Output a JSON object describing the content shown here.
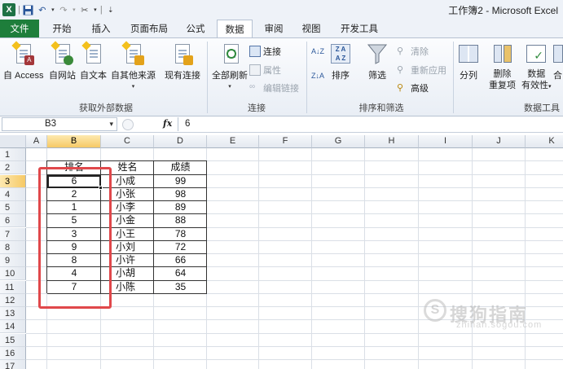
{
  "window": {
    "title": "工作簿2 - Microsoft Excel"
  },
  "quick_access": {
    "icons": [
      "excel-logo",
      "save-icon",
      "undo-icon",
      "redo-icon",
      "customize-icon"
    ]
  },
  "tabs": [
    {
      "label": "文件",
      "kind": "file"
    },
    {
      "label": "开始"
    },
    {
      "label": "插入"
    },
    {
      "label": "页面布局"
    },
    {
      "label": "公式"
    },
    {
      "label": "数据",
      "active": true
    },
    {
      "label": "审阅"
    },
    {
      "label": "视图"
    },
    {
      "label": "开发工具"
    }
  ],
  "ribbon": {
    "get_external": {
      "group_label": "获取外部数据",
      "buttons": [
        "自 Access",
        "自网站",
        "自文本",
        "自其他来源",
        "现有连接"
      ]
    },
    "connections": {
      "group_label": "连接",
      "refresh_all": "全部刷新",
      "connections": "连接",
      "properties": "属性",
      "edit_links": "编辑链接"
    },
    "sort_filter": {
      "group_label": "排序和筛选",
      "sort_az": "A↓Z",
      "sort_za": "Z↓A",
      "sort": "排序",
      "filter": "筛选",
      "clear": "清除",
      "reapply": "重新应用",
      "advanced": "高级"
    },
    "data_tools": {
      "group_label": "数据工具",
      "text_to_columns": "分列",
      "remove_duplicates_1": "删除",
      "remove_duplicates_2": "重复项",
      "data_validation_1": "数据",
      "data_validation_2": "有效性",
      "consolidate": "合"
    }
  },
  "formula_bar": {
    "name_box": "B3",
    "fx_label": "fx",
    "value": "6"
  },
  "columns": [
    "A",
    "B",
    "C",
    "D",
    "E",
    "F",
    "G",
    "H",
    "I",
    "J",
    "K"
  ],
  "rows": [
    "1",
    "2",
    "3",
    "4",
    "5",
    "6",
    "7",
    "8",
    "9",
    "10",
    "11",
    "12",
    "13",
    "14",
    "15",
    "16",
    "17"
  ],
  "table": {
    "headers": [
      "排名",
      "姓名",
      "成绩"
    ],
    "rows": [
      [
        "6",
        "小成",
        "99"
      ],
      [
        "2",
        "小张",
        "98"
      ],
      [
        "1",
        "小李",
        "89"
      ],
      [
        "5",
        "小金",
        "88"
      ],
      [
        "3",
        "小王",
        "78"
      ],
      [
        "9",
        "小刘",
        "72"
      ],
      [
        "8",
        "小许",
        "66"
      ],
      [
        "4",
        "小胡",
        "64"
      ],
      [
        "7",
        "小陈",
        "35"
      ]
    ]
  },
  "selection": {
    "active_cell": "B3"
  },
  "annotation": {
    "highlight_color": "#e0484b"
  },
  "watermark": {
    "text": "搜狗指南",
    "url": "zhinan.sogou.com",
    "glyph": "S"
  }
}
